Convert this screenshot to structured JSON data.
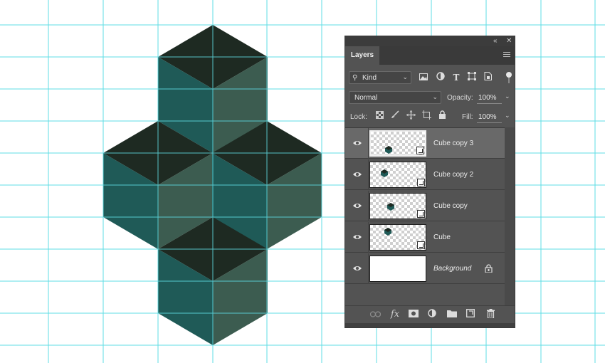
{
  "colors": {
    "guide": "#5fdde4",
    "dark_face": "#1e2a22",
    "teal_face": "#1f5a57",
    "gray_face": "#3c5c50",
    "panel_bg": "#535353",
    "selected_row": "#696969"
  },
  "panel": {
    "collapse_icon": "double-chevron-icon",
    "close_icon": "close-icon",
    "tab_label": "Layers",
    "menu_icon": "hamburger-menu-icon"
  },
  "filter": {
    "kind_label": "Kind",
    "icons": [
      "image-filter-icon",
      "adjustment-filter-icon",
      "type-filter-icon",
      "shape-filter-icon",
      "smart-object-filter-icon"
    ]
  },
  "blend": {
    "mode": "Normal",
    "opacity_label": "Opacity:",
    "opacity_value": "100%"
  },
  "lock": {
    "label": "Lock:",
    "icons": [
      "lock-transparent-icon",
      "lock-image-icon",
      "lock-position-icon",
      "lock-artboard-icon",
      "lock-all-icon"
    ],
    "fill_label": "Fill:",
    "fill_value": "100%"
  },
  "layers": [
    {
      "name": "Cube copy 3",
      "selected": true,
      "smart_object": true
    },
    {
      "name": "Cube copy 2",
      "selected": false,
      "smart_object": true
    },
    {
      "name": "Cube copy",
      "selected": false,
      "smart_object": true
    },
    {
      "name": "Cube",
      "selected": false,
      "smart_object": true
    },
    {
      "name": "Background",
      "selected": false,
      "smart_object": false,
      "locked": true
    }
  ],
  "bottom_icons": [
    "link-layers-icon",
    "fx-icon",
    "add-mask-icon",
    "adjustment-layer-icon",
    "new-group-icon",
    "new-layer-icon",
    "delete-layer-icon"
  ]
}
